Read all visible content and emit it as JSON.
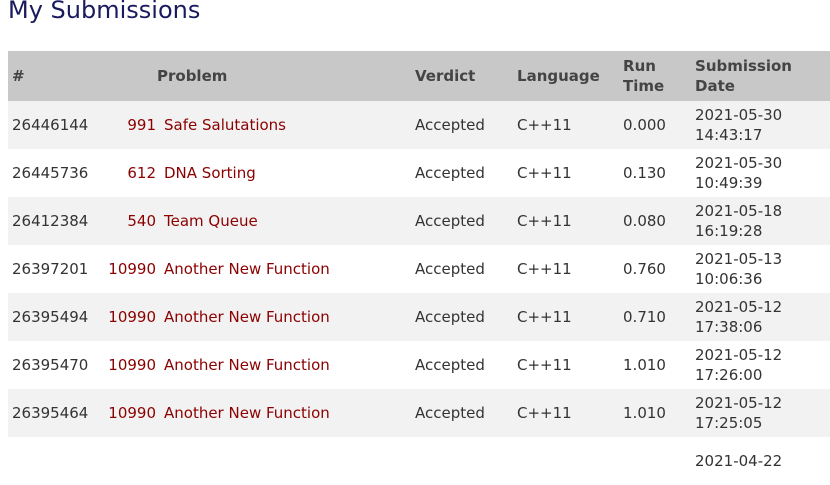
{
  "page": {
    "title": "My Submissions"
  },
  "table": {
    "headers": {
      "id": "#",
      "problem": "Problem",
      "verdict": "Verdict",
      "language": "Language",
      "run_time": "Run Time",
      "date": "Submission Date"
    },
    "rows": [
      {
        "id": "26446144",
        "problem_num": "991",
        "problem_name": "Safe Salutations",
        "verdict": "Accepted",
        "language": "C++11",
        "run_time": "0.000",
        "date": "2021-05-30",
        "time": "14:43:17"
      },
      {
        "id": "26445736",
        "problem_num": "612",
        "problem_name": "DNA Sorting",
        "verdict": "Accepted",
        "language": "C++11",
        "run_time": "0.130",
        "date": "2021-05-30",
        "time": "10:49:39"
      },
      {
        "id": "26412384",
        "problem_num": "540",
        "problem_name": "Team Queue",
        "verdict": "Accepted",
        "language": "C++11",
        "run_time": "0.080",
        "date": "2021-05-18",
        "time": "16:19:28"
      },
      {
        "id": "26397201",
        "problem_num": "10990",
        "problem_name": "Another New Function",
        "verdict": "Accepted",
        "language": "C++11",
        "run_time": "0.760",
        "date": "2021-05-13",
        "time": "10:06:36"
      },
      {
        "id": "26395494",
        "problem_num": "10990",
        "problem_name": "Another New Function",
        "verdict": "Accepted",
        "language": "C++11",
        "run_time": "0.710",
        "date": "2021-05-12",
        "time": "17:38:06"
      },
      {
        "id": "26395470",
        "problem_num": "10990",
        "problem_name": "Another New Function",
        "verdict": "Accepted",
        "language": "C++11",
        "run_time": "1.010",
        "date": "2021-05-12",
        "time": "17:26:00"
      },
      {
        "id": "26395464",
        "problem_num": "10990",
        "problem_name": "Another New Function",
        "verdict": "Accepted",
        "language": "C++11",
        "run_time": "1.010",
        "date": "2021-05-12",
        "time": "17:25:05"
      },
      {
        "id": "",
        "problem_num": "",
        "problem_name": "",
        "verdict": "",
        "language": "",
        "run_time": "",
        "date": "2021-04-22",
        "time": ""
      }
    ]
  },
  "colors": {
    "link": "#8b0000",
    "title": "#1a1a5e",
    "header_bg": "#c8c8c8",
    "row_alt": "#f2f2f2"
  }
}
